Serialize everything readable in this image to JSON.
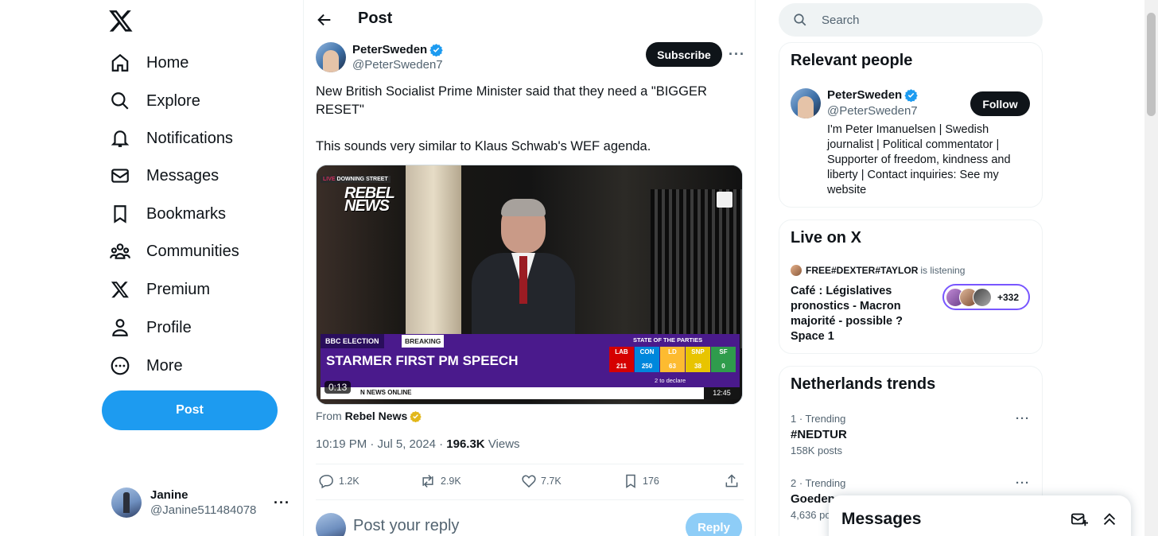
{
  "nav": {
    "items": [
      {
        "label": "Home",
        "icon": "home-icon"
      },
      {
        "label": "Explore",
        "icon": "search-icon"
      },
      {
        "label": "Notifications",
        "icon": "bell-icon"
      },
      {
        "label": "Messages",
        "icon": "envelope-icon"
      },
      {
        "label": "Bookmarks",
        "icon": "bookmark-icon"
      },
      {
        "label": "Communities",
        "icon": "people-icon"
      },
      {
        "label": "Premium",
        "icon": "x-logo-icon"
      },
      {
        "label": "Profile",
        "icon": "person-icon"
      },
      {
        "label": "More",
        "icon": "more-circle-icon"
      }
    ],
    "post_button": "Post",
    "account": {
      "name": "Janine",
      "handle": "@Janine511484078"
    }
  },
  "header": {
    "title": "Post"
  },
  "tweet": {
    "author_name": "PeterSweden",
    "author_handle": "@PeterSweden7",
    "subscribe_label": "Subscribe",
    "text_line1": "New British Socialist Prime Minister said that they need a \"BIGGER RESET\"",
    "text_line2": "This sounds very similar to Klaus Schwab's WEF agenda.",
    "video": {
      "live_tag": "LIVE",
      "location_tag": "DOWNING STREET",
      "brand_line1": "REBEL",
      "brand_line2": "NEWS",
      "bbc_tag": "BBC ELECTION",
      "breaking_tag": "BREAKING",
      "headline": "STARMER FIRST PM SPEECH",
      "state_title": "STATE OF THE PARTIES",
      "parties": [
        {
          "name": "LAB",
          "seats": "211",
          "color": "#d50000"
        },
        {
          "name": "CON",
          "seats": "250",
          "color": "#0087dc"
        },
        {
          "name": "LD",
          "seats": "63",
          "color": "#fdbb30"
        },
        {
          "name": "SNP",
          "seats": "38",
          "color": "#e8c400"
        },
        {
          "name": "SF",
          "seats": "0",
          "color": "#2f9c4c"
        }
      ],
      "declare_text": "2 to declare",
      "ticker_text": "N NEWS ONLINE",
      "clock": "12:45",
      "elapsed": "0:13"
    },
    "from_prefix": "From",
    "from_source": "Rebel News",
    "timestamp": "10:19 PM · Jul 5, 2024 ·",
    "views_count": "196.3K",
    "views_label": "Views",
    "replies": "1.2K",
    "reposts": "2.9K",
    "likes": "7.7K",
    "bookmarks": "176",
    "reply_placeholder": "Post your reply",
    "reply_button": "Reply"
  },
  "search": {
    "placeholder": "Search"
  },
  "relevant_people": {
    "title": "Relevant people",
    "name": "PeterSweden",
    "handle": "@PeterSweden7",
    "follow_label": "Follow",
    "bio": "I'm Peter Imanuelsen | Swedish journalist | Political commentator | Supporter of freedom, kindness and liberty | Contact inquiries: See my website"
  },
  "live": {
    "title": "Live on X",
    "host": "FREE#DEXTER#TAYLOR",
    "host_status": "is listening",
    "space_title": "Café : Législatives pronostics - Macron majorité - possible ? Space 1",
    "listener_count": "+332"
  },
  "trends": {
    "title": "Netherlands trends",
    "items": [
      {
        "meta": "1 · Trending",
        "name": "#NEDTUR",
        "count": "158K posts"
      },
      {
        "meta": "2 · Trending",
        "name": "Goeden",
        "count": "4,636 po"
      }
    ]
  },
  "messages_drawer": {
    "title": "Messages"
  },
  "colors": {
    "accent": "#1d9bf0",
    "text": "#0f1419",
    "muted": "#536471",
    "verified": "#1d9bf0",
    "gold": "#e2b719"
  }
}
